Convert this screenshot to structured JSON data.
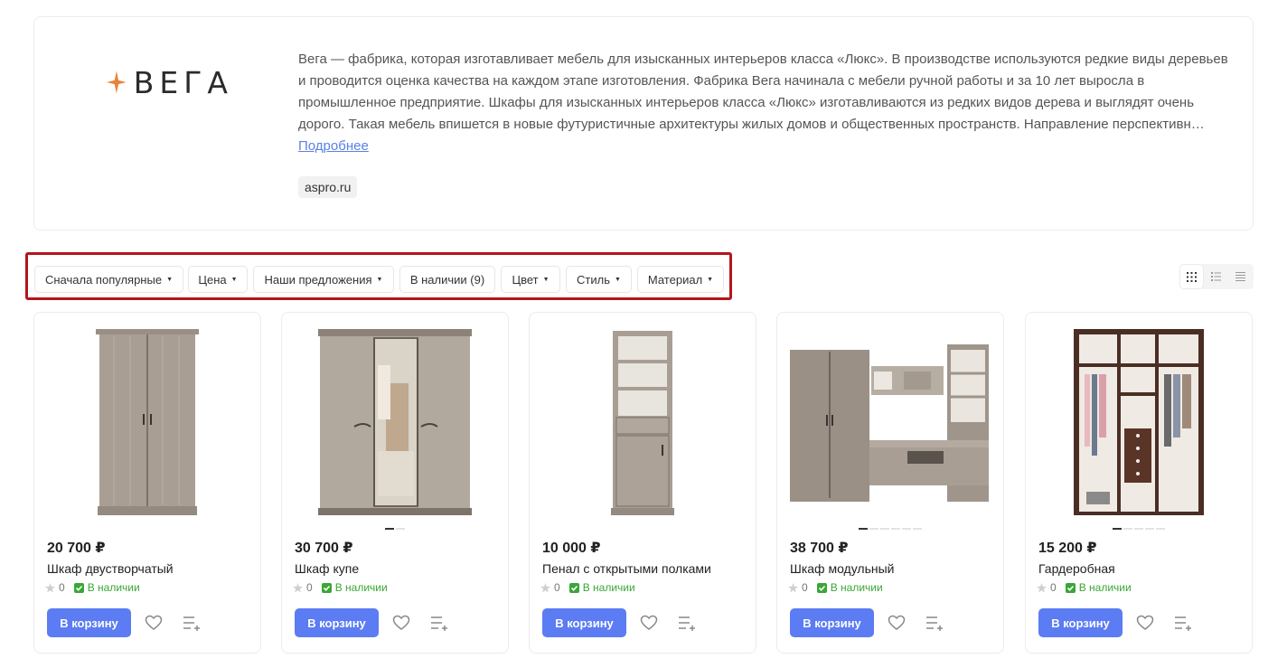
{
  "brand": {
    "logo_text": "ВЕГА",
    "description": "Вега — фабрика, которая изготавливает мебель для изысканных интерьеров класса «Люкс». В производстве используются редкие виды деревьев и проводится оценка качества на каждом этапе изготовления. Фабрика Вега начинала с мебели ручной работы и за 10 лет выросла в промышленное предприятие. Шкафы для изысканных интерьеров класса «Люкс» изготавливаются из редких видов дерева и выглядят очень дорого. Такая мебель впишется в новые футуристичные архитектуры жилых домов и общественных пространств. Направление перспективн…",
    "more_link": "Подробнее",
    "site": "aspro.ru",
    "accent_color": "#e8833a"
  },
  "filters": [
    {
      "label": "Сначала популярные",
      "has_caret": true
    },
    {
      "label": "Цена",
      "has_caret": true
    },
    {
      "label": "Наши предложения",
      "has_caret": true
    },
    {
      "label": "В наличии (9)",
      "has_caret": false
    },
    {
      "label": "Цвет",
      "has_caret": true
    },
    {
      "label": "Стиль",
      "has_caret": true
    },
    {
      "label": "Материал",
      "has_caret": true
    }
  ],
  "view_modes": [
    "grid-icon",
    "list-icon",
    "table-icon"
  ],
  "products": [
    {
      "price": "20 700 ₽",
      "name": "Шкаф двустворчатый",
      "rating": "0",
      "stock": "В наличии",
      "cart_label": "В корзину",
      "image_dots": 0,
      "active_dot": 0
    },
    {
      "price": "30 700 ₽",
      "name": "Шкаф купе",
      "rating": "0",
      "stock": "В наличии",
      "cart_label": "В корзину",
      "image_dots": 2,
      "active_dot": 0
    },
    {
      "price": "10 000 ₽",
      "name": "Пенал с открытыми полками",
      "rating": "0",
      "stock": "В наличии",
      "cart_label": "В корзину",
      "image_dots": 0,
      "active_dot": 0
    },
    {
      "price": "38 700 ₽",
      "name": "Шкаф модульный",
      "rating": "0",
      "stock": "В наличии",
      "cart_label": "В корзину",
      "image_dots": 6,
      "active_dot": 0
    },
    {
      "price": "15 200 ₽",
      "name": "Гардеробная",
      "rating": "0",
      "stock": "В наличии",
      "cart_label": "В корзину",
      "image_dots": 5,
      "active_dot": 0
    }
  ],
  "colors": {
    "primary_button": "#5b7cf2",
    "in_stock": "#3aa636",
    "highlight_border": "#b3161b",
    "link": "#5a80e6"
  }
}
